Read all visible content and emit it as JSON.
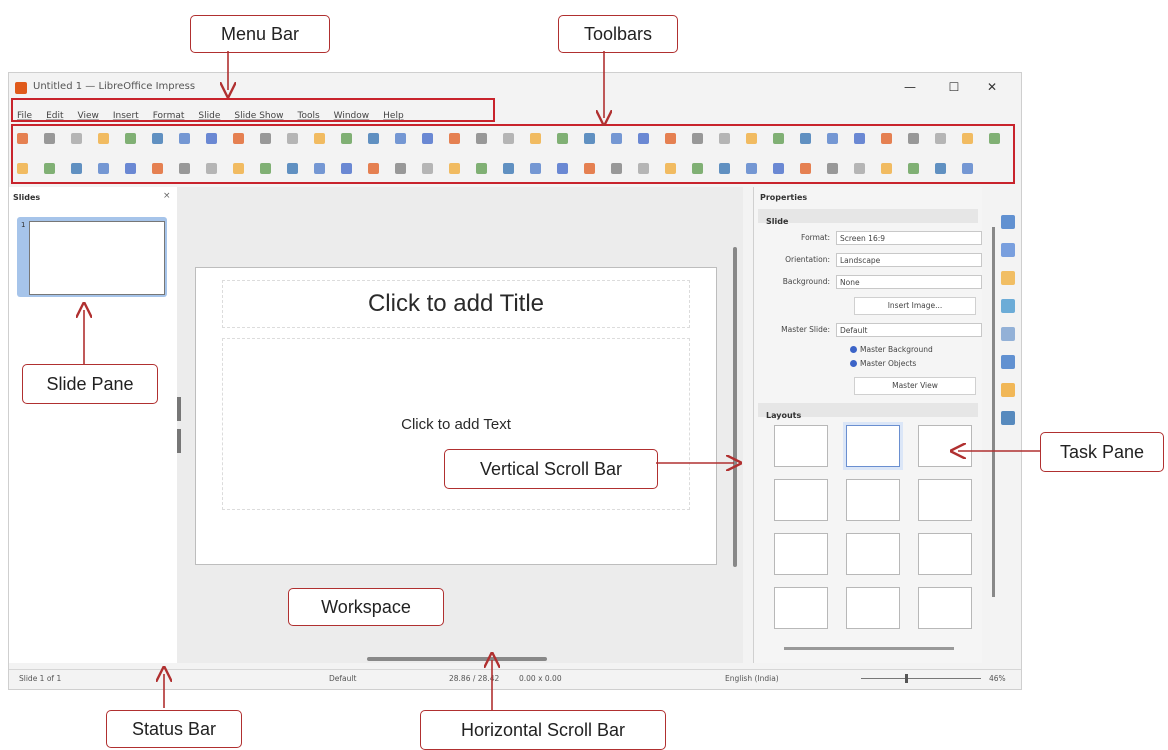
{
  "window": {
    "title": "Untitled 1 — LibreOffice Impress",
    "controls": [
      "—",
      "☐",
      "✕"
    ]
  },
  "menu": [
    "File",
    "Edit",
    "View",
    "Insert",
    "Format",
    "Slide",
    "Slide Show",
    "Tools",
    "Window",
    "Help"
  ],
  "slides_pane": {
    "title": "Slides",
    "close": "×",
    "thumb_number": "1"
  },
  "slide": {
    "title_placeholder": "Click to add Title",
    "body_placeholder": "Click to add Text"
  },
  "properties": {
    "title": "Properties",
    "slide_section": "Slide",
    "format_label": "Format:",
    "format_value": "Screen 16:9",
    "orientation_label": "Orientation:",
    "orientation_value": "Landscape",
    "background_label": "Background:",
    "background_value": "None",
    "insert_image": "Insert Image...",
    "master_slide_label": "Master Slide:",
    "master_slide_value": "Default",
    "master_background": "Master Background",
    "master_objects": "Master Objects",
    "master_view": "Master View",
    "layouts_section": "Layouts"
  },
  "status": {
    "slide": "Slide 1 of 1",
    "master": "Default",
    "position": "28.86 / 28.42",
    "size": "0.00 x 0.00",
    "language": "English (India)",
    "zoom": "46%"
  },
  "annotations": {
    "menu_bar": "Menu Bar",
    "toolbars": "Toolbars",
    "slide_pane": "Slide Pane",
    "task_pane": "Task Pane",
    "vertical_scroll_bar": "Vertical Scroll Bar",
    "workspace": "Workspace",
    "status_bar": "Status Bar",
    "horizontal_scroll_bar": "Horizontal Scroll Bar"
  },
  "colors": {
    "annotation_border": "#b03030",
    "highlight": "#c8232c",
    "selection": "#a6c4ea"
  }
}
